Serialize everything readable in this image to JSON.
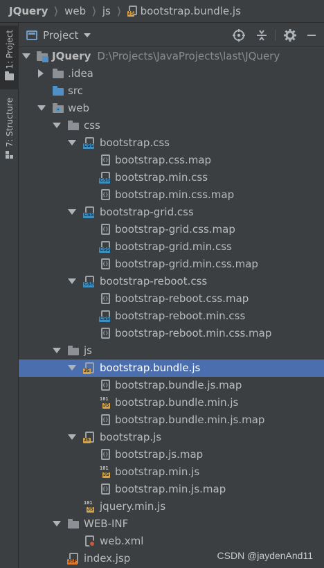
{
  "breadcrumb": [
    {
      "label": "JQuery",
      "icon": null
    },
    {
      "label": "web",
      "icon": null
    },
    {
      "label": "js",
      "icon": null
    },
    {
      "label": "bootstrap.bundle.js",
      "icon": "js-file-icon"
    }
  ],
  "tool_strip": {
    "project_tab": "1: Project",
    "structure_tab": "7: Structure"
  },
  "panel": {
    "view_label": "Project",
    "icons": [
      "locate-target-icon",
      "collapse-all-icon",
      "gear-icon",
      "minimize-icon"
    ]
  },
  "tree": {
    "root_label": "JQuery",
    "root_path": "D:\\Projects\\JavaProjects\\last\\JQuery",
    "items": [
      {
        "label": ".idea",
        "kind": "folder",
        "expanded": false
      },
      {
        "label": "src",
        "kind": "source-folder"
      },
      {
        "label": "web",
        "kind": "web-folder",
        "expanded": true
      },
      {
        "label": "css",
        "kind": "folder",
        "expanded": true
      },
      {
        "label": "bootstrap.css",
        "kind": "css",
        "expanded": true
      },
      {
        "label": "bootstrap.css.map",
        "kind": "map"
      },
      {
        "label": "bootstrap.min.css",
        "kind": "css"
      },
      {
        "label": "bootstrap.min.css.map",
        "kind": "map"
      },
      {
        "label": "bootstrap-grid.css",
        "kind": "css",
        "expanded": true
      },
      {
        "label": "bootstrap-grid.css.map",
        "kind": "map"
      },
      {
        "label": "bootstrap-grid.min.css",
        "kind": "css"
      },
      {
        "label": "bootstrap-grid.min.css.map",
        "kind": "map"
      },
      {
        "label": "bootstrap-reboot.css",
        "kind": "css",
        "expanded": true
      },
      {
        "label": "bootstrap-reboot.css.map",
        "kind": "map"
      },
      {
        "label": "bootstrap-reboot.min.css",
        "kind": "css"
      },
      {
        "label": "bootstrap-reboot.min.css.map",
        "kind": "map"
      },
      {
        "label": "js",
        "kind": "folder",
        "expanded": true
      },
      {
        "label": "bootstrap.bundle.js",
        "kind": "js",
        "expanded": true,
        "selected": true
      },
      {
        "label": "bootstrap.bundle.js.map",
        "kind": "map"
      },
      {
        "label": "bootstrap.bundle.min.js",
        "kind": "minjs"
      },
      {
        "label": "bootstrap.bundle.min.js.map",
        "kind": "map"
      },
      {
        "label": "bootstrap.js",
        "kind": "js",
        "expanded": true
      },
      {
        "label": "bootstrap.js.map",
        "kind": "map"
      },
      {
        "label": "bootstrap.min.js",
        "kind": "minjs"
      },
      {
        "label": "bootstrap.min.js.map",
        "kind": "map"
      },
      {
        "label": "jquery.min.js",
        "kind": "minjs"
      },
      {
        "label": "WEB-INF",
        "kind": "folder",
        "expanded": true
      },
      {
        "label": "web.xml",
        "kind": "xml"
      },
      {
        "label": "index.jsp",
        "kind": "jsp"
      }
    ]
  },
  "watermark": "CSDN @jaydenAnd11",
  "colors": {
    "background": "#3c3f41",
    "selection": "#4b6eaf",
    "css_badge": "#3d8fbf",
    "js_badge": "#d9a341",
    "jsp_badge": "#e07a2a"
  }
}
